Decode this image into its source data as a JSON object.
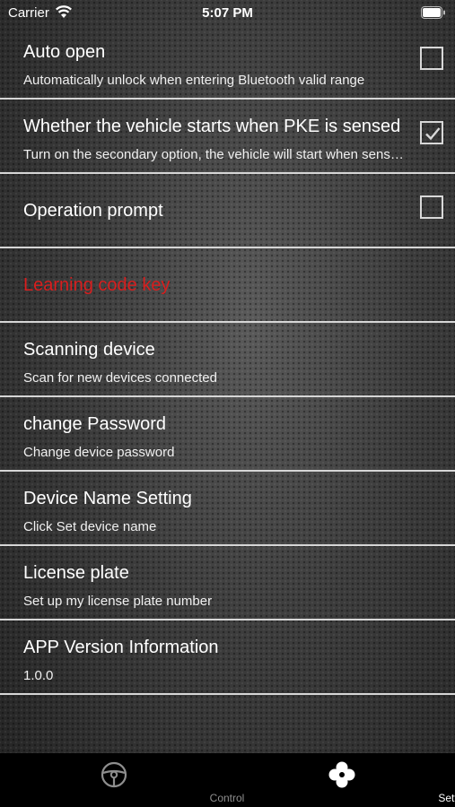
{
  "status_bar": {
    "carrier": "Carrier",
    "time": "5:07 PM"
  },
  "settings": [
    {
      "title": "Auto open",
      "subtitle": "Automatically unlock when entering Bluetooth valid range",
      "checkbox": false
    },
    {
      "title": "Whether the vehicle starts when PKE is sensed",
      "subtitle": "Turn on the secondary option, the vehicle will start when sensed",
      "checkbox": true
    },
    {
      "title": "Operation prompt",
      "checkbox": false
    },
    {
      "title": "Learning code key",
      "color": "#d81e1e"
    },
    {
      "title": "Scanning device",
      "subtitle": "Scan for new devices connected"
    },
    {
      "title": "change Password",
      "subtitle": "Change device password"
    },
    {
      "title": "Device Name Setting",
      "subtitle": "Click Set device name"
    },
    {
      "title": "License plate",
      "subtitle": "Set up my license plate number"
    },
    {
      "title": "APP Version Information",
      "subtitle": "1.0.0"
    }
  ],
  "tab_bar": {
    "tabs": [
      {
        "label": "Control",
        "icon": "steering-wheel-icon",
        "active": false
      },
      {
        "label": "Setting",
        "icon": "clover-icon",
        "active": true
      }
    ],
    "active_color": "#ffffff",
    "inactive_color": "#8e8e8e"
  }
}
